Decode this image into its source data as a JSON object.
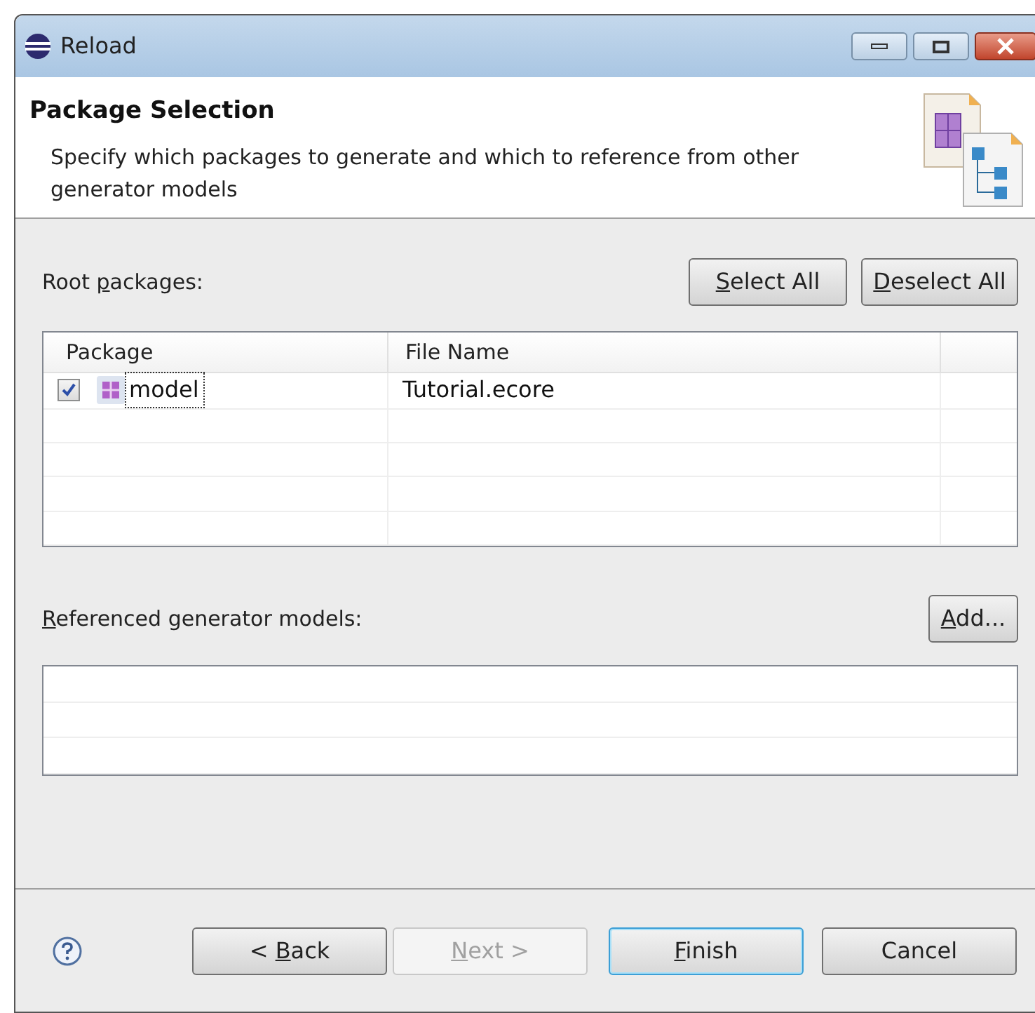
{
  "window": {
    "title": "Reload"
  },
  "header": {
    "title": "Package Selection",
    "description": "Specify which packages to generate and which to reference from other generator models"
  },
  "root_packages": {
    "label": {
      "pre": "Root ",
      "key": "p",
      "post": "ackages:"
    },
    "buttons": [
      {
        "key": "S",
        "post": "elect All"
      },
      {
        "key": "D",
        "post": "eselect All"
      }
    ],
    "columns": [
      "Package",
      "File Name"
    ],
    "rows": [
      {
        "checked": true,
        "package": "model",
        "file_name": "Tutorial.ecore"
      }
    ]
  },
  "referenced": {
    "label": {
      "key": "R",
      "post": "eferenced generator models:"
    },
    "button": {
      "key": "A",
      "post": "dd..."
    }
  },
  "footer": {
    "buttons": [
      {
        "pre": "< ",
        "key": "B",
        "post": "ack",
        "disabled": false,
        "default": false
      },
      {
        "key": "N",
        "post": "ext >",
        "disabled": true,
        "default": false
      },
      {
        "key": "F",
        "post": "inish",
        "disabled": false,
        "default": true
      },
      {
        "post": "Cancel",
        "disabled": false,
        "default": false
      }
    ]
  }
}
